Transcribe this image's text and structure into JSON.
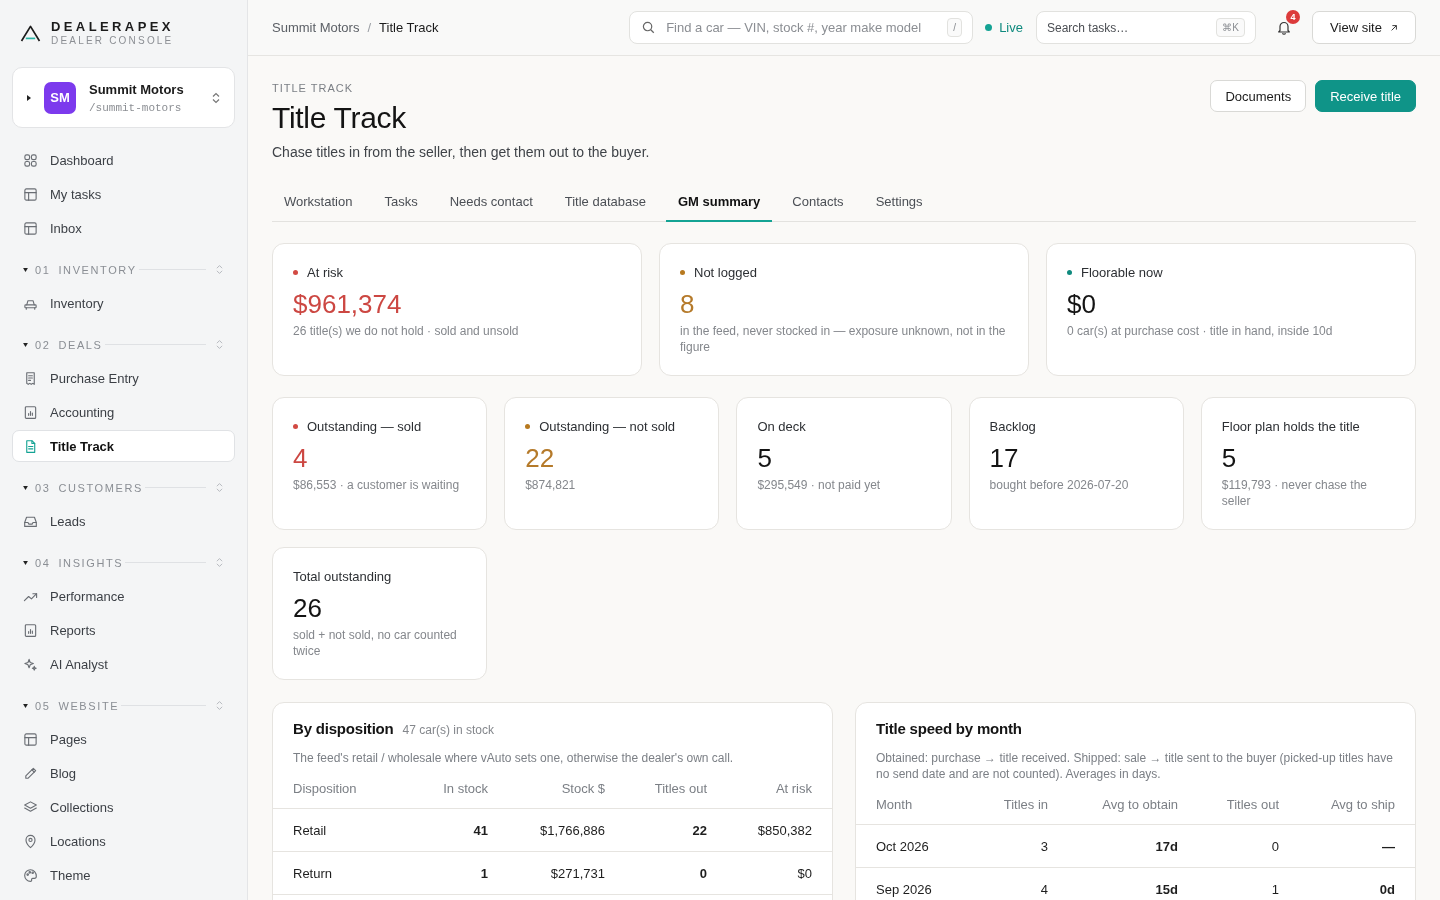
{
  "brand": {
    "name": "DEALERAPEX",
    "tagline": "DEALER CONSOLE"
  },
  "workspace": {
    "initials": "SM",
    "name": "Summit Motors",
    "slug": "/summit-motors"
  },
  "sidebar": {
    "items": [
      {
        "label": "Dashboard",
        "selected": false
      },
      {
        "label": "My tasks",
        "selected": false
      },
      {
        "label": "Inbox",
        "selected": false
      }
    ],
    "sections": [
      {
        "number": "01",
        "title": "INVENTORY",
        "expanded": true,
        "items": [
          {
            "label": "Inventory",
            "selected": false
          }
        ]
      },
      {
        "number": "02",
        "title": "DEALS",
        "expanded": true,
        "items": [
          {
            "label": "Purchase Entry",
            "selected": false
          },
          {
            "label": "Accounting",
            "selected": false
          },
          {
            "label": "Title Track",
            "selected": true
          }
        ]
      },
      {
        "number": "03",
        "title": "CUSTOMERS",
        "expanded": true,
        "items": [
          {
            "label": "Leads",
            "selected": false
          }
        ]
      },
      {
        "number": "04",
        "title": "INSIGHTS",
        "expanded": true,
        "items": [
          {
            "label": "Performance",
            "selected": false
          },
          {
            "label": "Reports",
            "selected": false
          },
          {
            "label": "AI Analyst",
            "selected": false
          }
        ]
      },
      {
        "number": "05",
        "title": "WEBSITE",
        "expanded": true,
        "items": [
          {
            "label": "Pages",
            "selected": false
          },
          {
            "label": "Blog",
            "selected": false
          },
          {
            "label": "Collections",
            "selected": false
          },
          {
            "label": "Locations",
            "selected": false
          },
          {
            "label": "Theme",
            "selected": false
          }
        ]
      }
    ]
  },
  "topbar": {
    "breadcrumb": [
      {
        "label": "Summit Motors"
      },
      {
        "label": "Title Track"
      }
    ],
    "separator": "/",
    "car_search": {
      "placeholder": "Find a car — VIN, stock #, year make model",
      "shortcut": "/"
    },
    "live": "Live",
    "task_search": {
      "placeholder": "Search tasks…",
      "shortcut": "⌘K"
    },
    "notification_count": "4",
    "view_site": "View site"
  },
  "header": {
    "eyebrow": "TITLE TRACK",
    "title": "Title Track",
    "subtitle": "Chase titles in from the seller, then get them out to the buyer.",
    "buttons": [
      {
        "label": "Documents",
        "kind": "secondary"
      },
      {
        "label": "Receive title",
        "kind": "primary"
      }
    ]
  },
  "tabs": [
    {
      "label": "Workstation",
      "selected": false
    },
    {
      "label": "Tasks",
      "selected": false
    },
    {
      "label": "Needs contact",
      "selected": false
    },
    {
      "label": "Title database",
      "selected": false
    },
    {
      "label": "GM summary",
      "selected": true
    },
    {
      "label": "Contacts",
      "selected": false
    },
    {
      "label": "Settings",
      "selected": false
    }
  ],
  "headline_cards": [
    {
      "kind": "alert",
      "label": "At risk",
      "value": "$961,374",
      "note": "26 title(s) we do not hold · sold and unsold"
    },
    {
      "kind": "warn",
      "label": "Not logged",
      "value": "8",
      "note": "in the feed, never stocked in — exposure unknown, not in the figure"
    },
    {
      "kind": "ok",
      "label": "Floorable now",
      "value": "$0",
      "note": "0 car(s) at purchase cost · title in hand, inside 10d"
    }
  ],
  "detail_cards": [
    {
      "kind": "alert",
      "label": "Outstanding — sold",
      "value": "4",
      "note": "$86,553 · a customer is waiting"
    },
    {
      "kind": "warn",
      "label": "Outstanding — not sold",
      "value": "22",
      "note": "$874,821"
    },
    {
      "kind": "plain",
      "label": "On deck",
      "value": "5",
      "note": "$295,549 · not paid yet"
    },
    {
      "kind": "plain",
      "label": "Backlog",
      "value": "17",
      "note": "bought before 2026-07-20"
    },
    {
      "kind": "plain",
      "label": "Floor plan holds the title",
      "value": "5",
      "note": "$119,793 · never chase the seller"
    },
    {
      "kind": "plain",
      "label": "Total outstanding",
      "value": "26",
      "note": "sold + not sold, no car counted twice"
    }
  ],
  "disposition": {
    "title": "By disposition",
    "count": "47 car(s) in stock",
    "description": "The feed's retail / wholesale where vAuto sets one, otherwise the dealer's own call.",
    "columns": [
      {
        "label": "Disposition"
      },
      {
        "label": "In stock",
        "strong": true
      },
      {
        "label": "Stock $"
      },
      {
        "label": "Titles out",
        "strong": true
      },
      {
        "label": "At risk"
      }
    ],
    "rows": [
      [
        "Retail",
        "41",
        "$1,766,886",
        "22",
        "$850,382"
      ],
      [
        "Return",
        "1",
        "$271,731",
        "0",
        "$0"
      ]
    ]
  },
  "title_speed": {
    "title": "Title speed by month",
    "description": "Obtained: purchase → title received. Shipped: sale → title sent to the buyer (picked-up titles have no send date and are not counted). Averages in days.",
    "columns": [
      {
        "label": "Month"
      },
      {
        "label": "Titles in"
      },
      {
        "label": "Avg to obtain",
        "strong": true
      },
      {
        "label": "Titles out"
      },
      {
        "label": "Avg to ship",
        "strong": true
      }
    ],
    "rows": [
      [
        "Oct 2026",
        "3",
        "17d",
        "0",
        "—"
      ],
      [
        "Sep 2026",
        "4",
        "15d",
        "1",
        "0d"
      ]
    ]
  }
}
